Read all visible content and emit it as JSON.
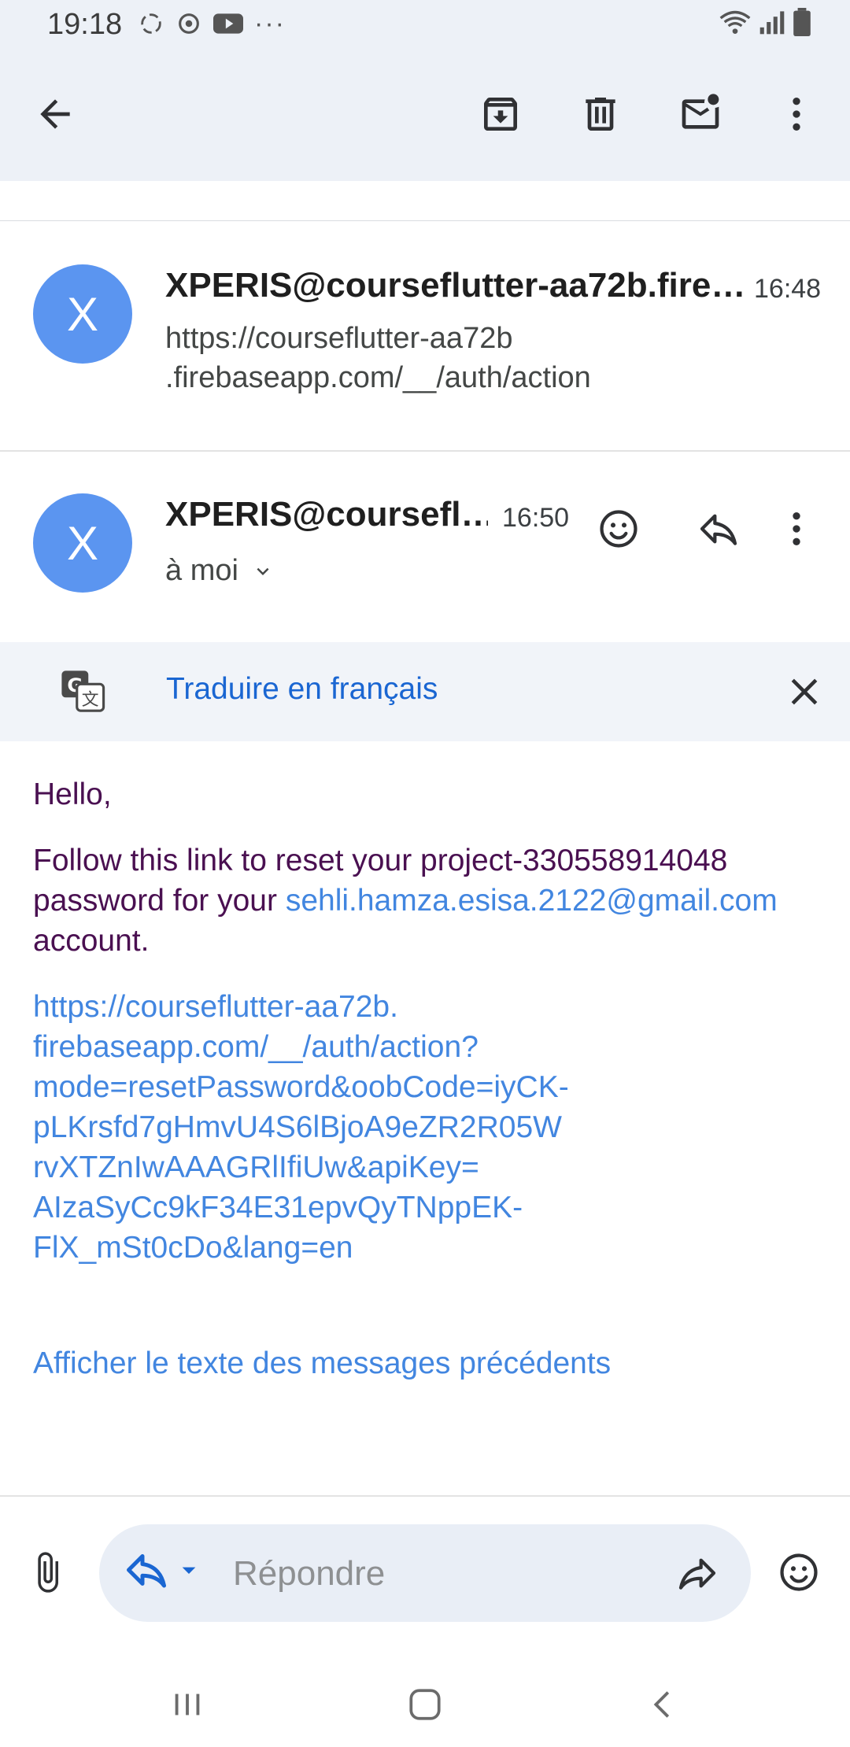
{
  "status_bar": {
    "time": "19:18"
  },
  "app_bar": {
    "back_label": "Back",
    "archive_label": "Archive",
    "delete_label": "Delete",
    "mark_unread_label": "Mark unread",
    "more_label": "More options"
  },
  "thread": {
    "collapsed_message": {
      "avatar_letter": "X",
      "sender": "XPERIS@courseflutter-aa72b.fire…",
      "time": "16:48",
      "snippet_line1": "https://courseflutter-aa72b",
      "snippet_line2": ".firebaseapp.com/__/auth/action"
    },
    "open_message": {
      "avatar_letter": "X",
      "sender": "XPERIS@coursefl…",
      "time": "16:50",
      "recipient": "à moi"
    }
  },
  "translate": {
    "link_text": "Traduire en français"
  },
  "email_body": {
    "greeting": "Hello,",
    "p1_prefix": "Follow this link to reset your project-330558914048 password for your ",
    "p1_email": "sehli.hamza.esisa.2122@gmail.com",
    "p1_suffix": " account.",
    "reset_link_lines": [
      "https://courseflutter-aa72b.",
      "firebaseapp.com/__/auth/action?",
      "mode=resetPassword&oobCode=iyCK-",
      "pLKrsfd7gHmvU4S6lBjoA9eZR2R05W",
      "rvXTZnIwAAAGRlIfiUw&apiKey=",
      "AIzaSyCc9kF34E31epvQyTNppEK-",
      "FlX_mSt0cDo&lang=en"
    ],
    "show_quoted": "Afficher le texte des messages précédents"
  },
  "reply_bar": {
    "placeholder": "Répondre"
  },
  "colors": {
    "app_bar_bg": "#edf1f7",
    "avatar_bg": "#5b95f0",
    "body_text": "#4a1051",
    "link": "#4286e0",
    "translate_link": "#1a66d2"
  }
}
